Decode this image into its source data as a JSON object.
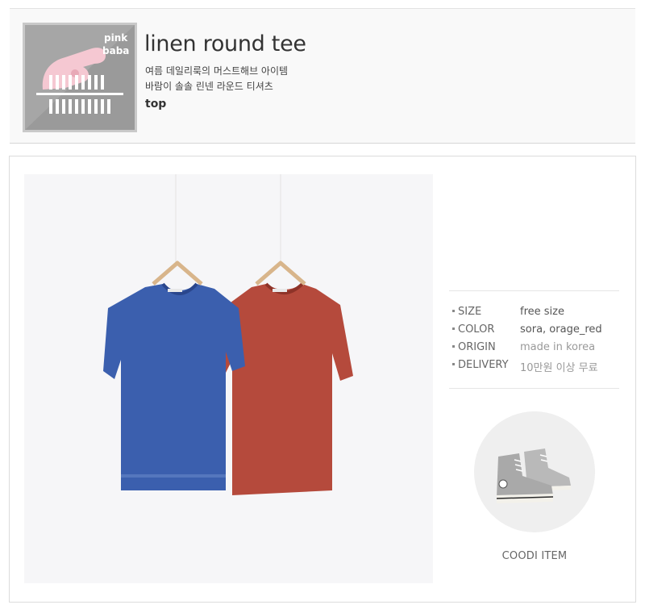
{
  "header": {
    "logo_text_line1": "pink",
    "logo_text_line2": "baba",
    "title": "linen round tee",
    "desc_line1": "여름 데일리룩의 머스트해브 아이템",
    "desc_line2": "바람이 솔솔 린넨 라운드 티셔츠",
    "category": "top"
  },
  "specs": [
    {
      "key": "SIZE",
      "value": "free size"
    },
    {
      "key": "COLOR",
      "value": "sora, orage_red"
    },
    {
      "key": "ORIGIN",
      "value": "made in korea"
    },
    {
      "key": "DELIVERY",
      "value": "10만원 이상 무료"
    }
  ],
  "coodi": {
    "label": "COODI ITEM"
  },
  "colors": {
    "blue_tee": "#3b5fae",
    "red_tee": "#b54a3c",
    "logo_pink": "#f5c8d2"
  }
}
